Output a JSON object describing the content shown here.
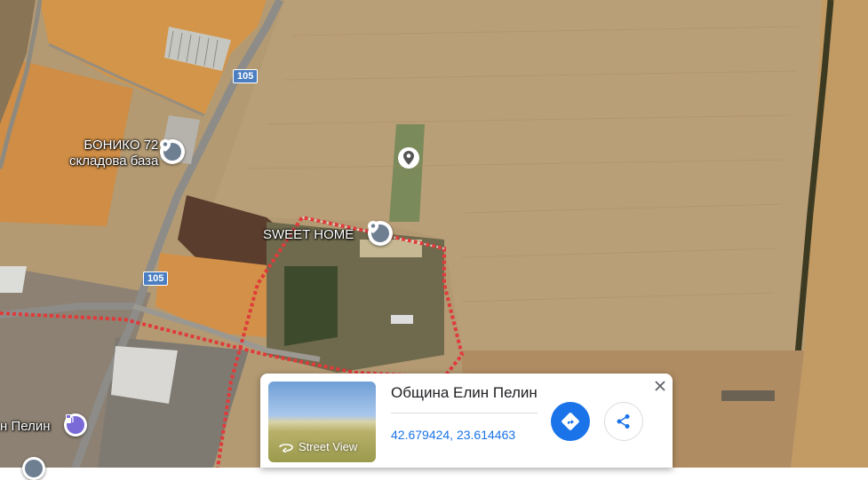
{
  "map": {
    "poi_boniko_line1": "БОНИКО 72",
    "poi_boniko_line2": "складова база",
    "poi_sweet_home": "SWEET HOME",
    "poi_elin_pelin_partial": "н Пелин",
    "road_number_top": "105",
    "road_number_bottom": "105"
  },
  "info_card": {
    "place_name": "Община Елин Пелин",
    "coordinates": "42.679424, 23.614463",
    "street_view_label": "Street View",
    "close_icon": "close-icon",
    "directions_icon": "directions-icon",
    "share_icon": "share-icon"
  },
  "colors": {
    "field_brown": "#b59a72",
    "field_orange": "#d2944a",
    "accent_blue": "#1a73e8",
    "boundary_red": "#e03b3b"
  }
}
